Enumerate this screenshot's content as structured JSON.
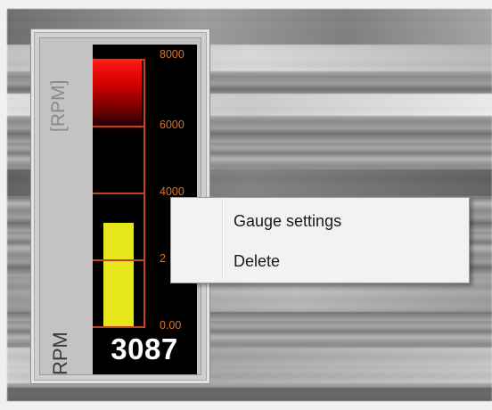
{
  "gauge": {
    "name_label_rotated": "[RPM]",
    "unit_label_rotated": "RPM",
    "readout": "3087",
    "scale_labels": [
      "8000",
      "6000",
      "4000",
      "2",
      "0.00"
    ],
    "max_value": 8000,
    "current_value": 3087,
    "redline_start": 6000,
    "colors": {
      "bar": "#e6e61a",
      "redline": "#ff1a1a",
      "scale": "#c2431b",
      "panel": "#000000"
    }
  },
  "context_menu": {
    "items": [
      {
        "label": "Gauge settings"
      },
      {
        "label": "Delete"
      }
    ]
  }
}
